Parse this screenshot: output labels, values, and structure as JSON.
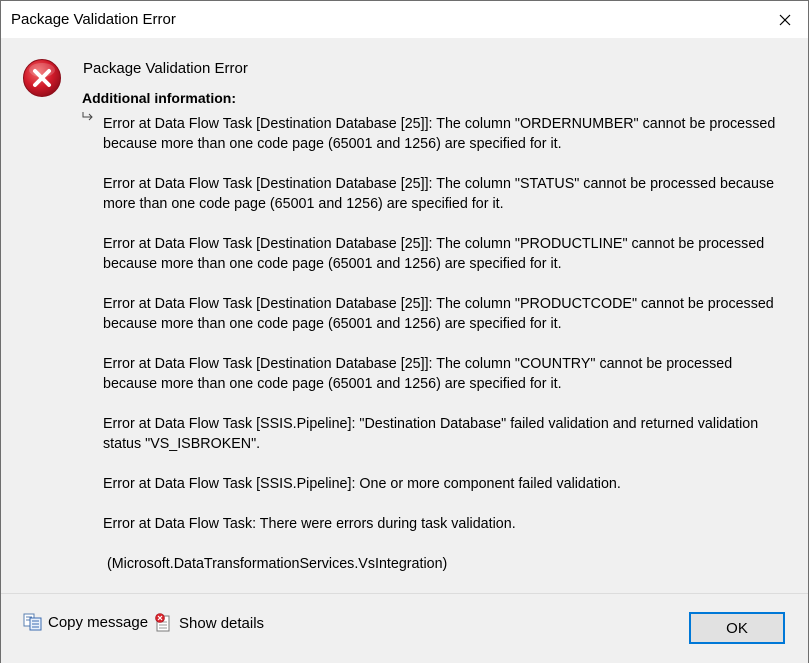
{
  "window": {
    "title": "Package Validation Error",
    "close_icon": "close-icon"
  },
  "content": {
    "icon": "error-icon",
    "heading": "Package Validation Error",
    "additional_info_label": "Additional information:",
    "arrow_icon": "expand-arrow-icon",
    "messages": [
      "Error at Data Flow Task [Destination Database [25]]: The column \"ORDERNUMBER\" cannot be processed because more than one code page (65001 and 1256) are specified for it.",
      "Error at Data Flow Task [Destination Database [25]]: The column \"STATUS\" cannot be processed because more than one code page (65001 and 1256) are specified for it.",
      "Error at Data Flow Task [Destination Database [25]]: The column \"PRODUCTLINE\" cannot be processed because more than one code page (65001 and 1256) are specified for it.",
      "Error at Data Flow Task [Destination Database [25]]: The column \"PRODUCTCODE\" cannot be processed because more than one code page (65001 and 1256) are specified for it.",
      "Error at Data Flow Task [Destination Database [25]]: The column \"COUNTRY\" cannot be processed because more than one code page (65001 and 1256) are specified for it.",
      "Error at Data Flow Task [SSIS.Pipeline]: \"Destination Database\" failed validation and returned validation status \"VS_ISBROKEN\".",
      "Error at Data Flow Task [SSIS.Pipeline]: One or more component failed validation.",
      "Error at Data Flow Task: There were errors during task validation.",
      " (Microsoft.DataTransformationServices.VsIntegration)"
    ]
  },
  "footer": {
    "copy_label": "Copy message",
    "copy_icon": "copy-icon",
    "details_label": "Show details",
    "details_icon": "details-icon",
    "ok_label": "OK"
  },
  "colors": {
    "error_red": "#c8102e",
    "accent_blue": "#0078d7"
  }
}
